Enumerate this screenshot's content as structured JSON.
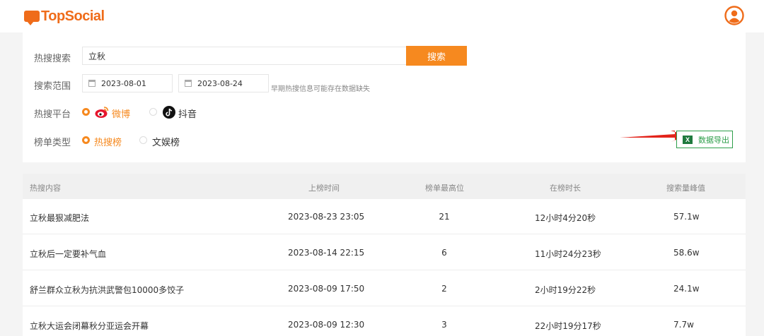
{
  "header": {
    "logo_text": "TopSocial",
    "avatar_icon": "user-avatar-icon",
    "accent_color": "#f6891f"
  },
  "filters": {
    "search_label": "热搜搜索",
    "search_value": "立秋",
    "search_button": "搜索",
    "range_label": "搜索范围",
    "start_date": "2023-08-01",
    "end_date": "2023-08-24",
    "range_hint": "早期热搜信息可能存在数据缺失",
    "platform_label": "热搜平台",
    "platforms": [
      {
        "label": "微博",
        "selected": true,
        "icon": "weibo-icon"
      },
      {
        "label": "抖音",
        "selected": false,
        "icon": "douyin-icon"
      }
    ],
    "type_label": "榜单类型",
    "types": [
      {
        "label": "热搜榜",
        "selected": true
      },
      {
        "label": "文娱榜",
        "selected": false
      }
    ],
    "export_button": "数据导出"
  },
  "table": {
    "columns": [
      "热搜内容",
      "上榜时间",
      "榜单最高位",
      "在榜时长",
      "搜索量峰值"
    ],
    "rows": [
      {
        "content": "立秋最狠减肥法",
        "time": "2023-08-23 23:05",
        "rank": "21",
        "duration": "12小时4分20秒",
        "peak": "57.1w"
      },
      {
        "content": "立秋后一定要补气血",
        "time": "2023-08-14 22:15",
        "rank": "6",
        "duration": "11小时24分23秒",
        "peak": "58.6w"
      },
      {
        "content": "舒兰群众立秋为抗洪武警包10000多饺子",
        "time": "2023-08-09 17:50",
        "rank": "2",
        "duration": "2小时19分22秒",
        "peak": "24.1w"
      },
      {
        "content": "立秋大运会闭幕秋分亚运会开幕",
        "time": "2023-08-09 12:30",
        "rank": "3",
        "duration": "22小时19分17秒",
        "peak": "7.7w"
      }
    ]
  }
}
